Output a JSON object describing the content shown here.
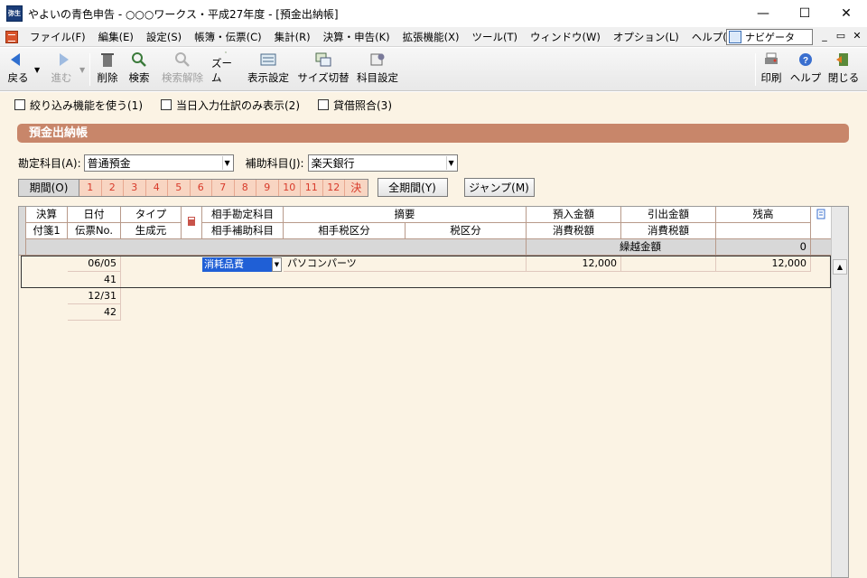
{
  "window": {
    "title": "やよいの青色申告 - ○○○ワークス・平成27年度 - [預金出納帳]",
    "app_icon_text": "弥生"
  },
  "menu": {
    "items": [
      "ファイル(F)",
      "編集(E)",
      "設定(S)",
      "帳簿・伝票(C)",
      "集計(R)",
      "決算・申告(K)",
      "拡張機能(X)",
      "ツール(T)",
      "ウィンドウ(W)",
      "オプション(L)",
      "ヘルプ(H)"
    ],
    "navigator": "ナビゲータ"
  },
  "toolbar": {
    "back": "戻る",
    "forward": "進む",
    "delete": "削除",
    "search": "検索",
    "clear_search": "検索解除",
    "zoom": "ズーム",
    "display_settings": "表示設定",
    "size_switch": "サイズ切替",
    "account_settings": "科目設定",
    "print": "印刷",
    "help": "ヘルプ",
    "close": "閉じる"
  },
  "options": {
    "filter": "絞り込み機能を使う(1)",
    "today_only": "当日入力仕訳のみ表示(2)",
    "reconcile": "貸借照合(3)"
  },
  "ledger": {
    "title": "預金出納帳",
    "account_label": "勘定科目(A):",
    "account_value": "普通預金",
    "subaccount_label": "補助科目(J):",
    "subaccount_value": "楽天銀行",
    "period_label": "期間(O)",
    "months": [
      "1",
      "2",
      "3",
      "4",
      "5",
      "6",
      "7",
      "8",
      "9",
      "10",
      "11",
      "12",
      "決"
    ],
    "all_period_button": "全期間(Y)",
    "jump_button": "ジャンプ(M)"
  },
  "grid": {
    "headers_row1": {
      "kessan": "決算",
      "date": "日付",
      "type": "タイプ",
      "partner_account": "相手勘定科目",
      "summary": "摘要",
      "deposit": "預入金額",
      "withdrawal": "引出金額",
      "balance": "残高"
    },
    "headers_row2": {
      "tag": "付箋1",
      "slip": "伝票No.",
      "origin": "生成元",
      "partner_sub": "相手補助科目",
      "partner_tax": "相手税区分",
      "tax": "税区分",
      "deposit_tax": "消費税額",
      "withdrawal_tax": "消費税額"
    },
    "carryover_label": "繰越金額",
    "carryover_value": "0",
    "rows": [
      {
        "date": "06/05",
        "slip": "41",
        "account": "消耗品費",
        "summary": "パソコンパーツ",
        "deposit": "12,000",
        "withdrawal": "",
        "balance": "12,000"
      },
      {
        "date": "12/31",
        "slip": "42",
        "account": "",
        "summary": "",
        "deposit": "",
        "withdrawal": "",
        "balance": ""
      }
    ]
  },
  "colors": {
    "header_band": "#c8866a",
    "panel_bg": "#fbf3e4",
    "month_bg": "#f8d5c2",
    "month_text": "#d83a2a",
    "selection": "#1f5fd6"
  }
}
